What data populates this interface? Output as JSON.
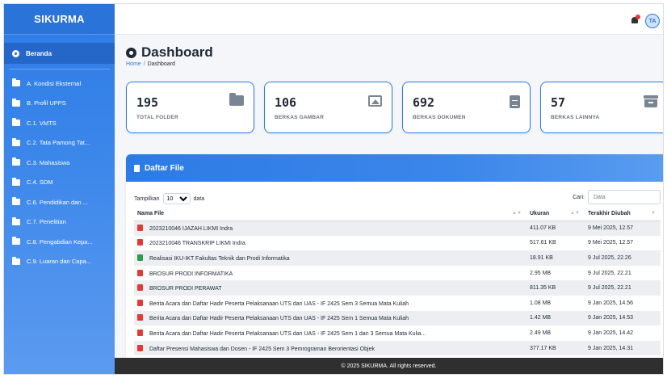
{
  "app": {
    "brand": "SIKURMA"
  },
  "sidebar": {
    "active": "Beranda",
    "items": [
      "A. Kondisi Eksternal",
      "B. Profil UPPS",
      "C.1. VMTS",
      "C.2. Tata Pamong Tat...",
      "C.3. Mahasiswa",
      "C.4. SDM",
      "C.6. Pendidikan dan ...",
      "C.7. Penelitian",
      "C.8. Pengabdian Kepa...",
      "C.9. Luaran dan Capa..."
    ]
  },
  "topbar": {
    "avatar": "TA",
    "icons": [
      "bell-icon",
      "avatar"
    ]
  },
  "page": {
    "title": "Dashboard",
    "breadcrumb": {
      "home": "Home",
      "sep": "/",
      "current": "Dashboard"
    }
  },
  "cards": [
    {
      "value": "195",
      "label": "TOTAL FOLDER",
      "icon": "folder-icon"
    },
    {
      "value": "106",
      "label": "BERKAS GAMBAR",
      "icon": "image-icon"
    },
    {
      "value": "692",
      "label": "BERKAS DOKUMEN",
      "icon": "document-icon"
    },
    {
      "value": "57",
      "label": "BERKAS LAINNYA",
      "icon": "archive-icon"
    }
  ],
  "files": {
    "title": "Daftar File",
    "show_label": "Tampilkan",
    "show_value": "10",
    "show_suffix": "data",
    "search_label": "Cari:",
    "search_placeholder": "Data",
    "columns": [
      "Nama File",
      "Ukuran",
      "Terakhir Diubah"
    ],
    "rows": [
      {
        "type": "pdf",
        "name": "2023210046 IJAZAH LIKMI Indra",
        "size": "411.07 KB",
        "date": "9 Mei 2025, 12.57"
      },
      {
        "type": "pdf",
        "name": "2023210046 TRANSKRIP LIKMI Indra",
        "size": "517.61 KB",
        "date": "9 Mei 2025, 12.57"
      },
      {
        "type": "xls",
        "name": "Realisasi IKU-IKT Fakultas Teknik dan Prodi Informatika",
        "size": "18.91 KB",
        "date": "9 Jul 2025, 22.26"
      },
      {
        "type": "pdf",
        "name": "BROSUR PRODI INFORMATIKA",
        "size": "2.95 MB",
        "date": "9 Jul 2025, 22.21"
      },
      {
        "type": "pdf",
        "name": "BROSUR PRODI PERAWAT",
        "size": "811.35 KB",
        "date": "9 Jul 2025, 22.21"
      },
      {
        "type": "pdf",
        "name": "Berita Acara dan Daftar Hadir Peserta Pelaksanaan UTS dan UAS - IF 2425 Sem 3 Semua Mata Kuliah",
        "size": "1.08 MB",
        "date": "9 Jan 2025, 14.56"
      },
      {
        "type": "pdf",
        "name": "Berita Acara dan Daftar Hadir Peserta Pelaksanaan UTS dan UAS - IF 2425 Sem 1 Semua Mata Kuliah",
        "size": "1.42 MB",
        "date": "9 Jan 2025, 14.53"
      },
      {
        "type": "pdf",
        "name": "Berita Acara dan Daftar Hadir Peserta Pelaksanaan UTS dan UAS - IF 2425 Sem 1 dan 3 Semua Mata Kulia...",
        "size": "2.49 MB",
        "date": "9 Jan 2025, 14.42"
      },
      {
        "type": "pdf",
        "name": "Daftar Presensi Mahasiswa dan Dosen - IF 2425 Sem 3 Pemrograman Berorientasi Objek",
        "size": "377.17 KB",
        "date": "9 Jan 2025, 14.31"
      }
    ]
  },
  "footer": {
    "text": "© 2025 SIKURMA. All rights reserved."
  }
}
